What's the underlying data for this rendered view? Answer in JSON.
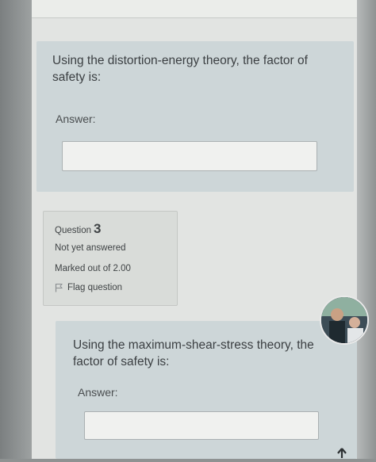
{
  "question2": {
    "text": "Using the distortion-energy theory, the factor of safety is:",
    "answer_label": "Answer:",
    "answer_value": ""
  },
  "question3": {
    "label_word": "Question",
    "number": "3",
    "status": "Not yet answered",
    "marked": "Marked out of 2.00",
    "flag_label": "Flag question",
    "text": "Using the maximum-shear-stress theory, the factor of safety is:",
    "answer_label": "Answer:",
    "answer_value": ""
  },
  "colors": {
    "formulation_bg": "#cdd6d8",
    "info_bg": "#d9dcd9",
    "text": "#3b3f42"
  },
  "icons": {
    "flag": "flag-icon",
    "avatar": "avatar",
    "scroll_up": "up-arrow-icon"
  }
}
